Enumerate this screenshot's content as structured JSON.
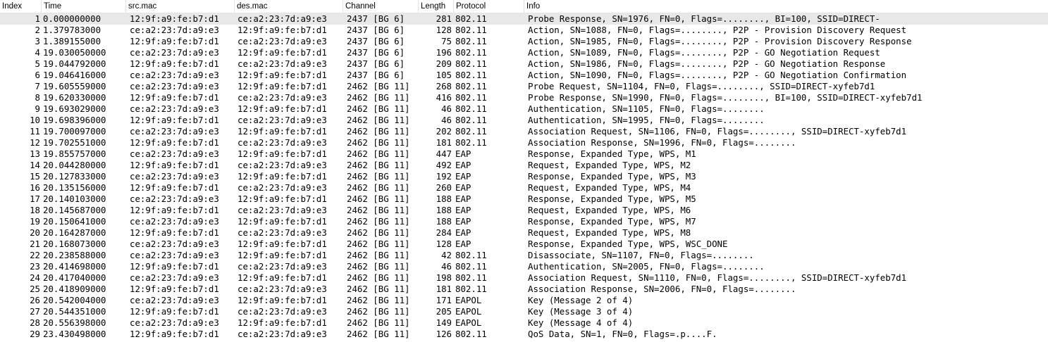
{
  "columns": {
    "index": "Index",
    "time": "Time",
    "src": "src.mac",
    "dst": "des.mac",
    "channel": "Channel",
    "length": "Length",
    "protocol": "Protocol",
    "info": "Info"
  },
  "rows": [
    {
      "index": "1",
      "time": "0.000000000",
      "src": "12:9f:a9:fe:b7:d1",
      "dst": "ce:a2:23:7d:a9:e3",
      "channel": "2437 [BG 6]",
      "length": "281",
      "protocol": "802.11",
      "info": "Probe Response, SN=1976, FN=0, Flags=........, BI=100, SSID=DIRECT-"
    },
    {
      "index": "2",
      "time": "1.379783000",
      "src": "ce:a2:23:7d:a9:e3",
      "dst": "12:9f:a9:fe:b7:d1",
      "channel": "2437 [BG 6]",
      "length": "128",
      "protocol": "802.11",
      "info": "Action, SN=1088, FN=0, Flags=........, P2P - Provision Discovery Request"
    },
    {
      "index": "3",
      "time": "1.389155000",
      "src": "12:9f:a9:fe:b7:d1",
      "dst": "ce:a2:23:7d:a9:e3",
      "channel": "2437 [BG 6]",
      "length": "75",
      "protocol": "802.11",
      "info": "Action, SN=1985, FN=0, Flags=........, P2P - Provision Discovery Response"
    },
    {
      "index": "4",
      "time": "19.030050000",
      "src": "ce:a2:23:7d:a9:e3",
      "dst": "12:9f:a9:fe:b7:d1",
      "channel": "2437 [BG 6]",
      "length": "196",
      "protocol": "802.11",
      "info": "Action, SN=1089, FN=0, Flags=........, P2P - GO Negotiation Request"
    },
    {
      "index": "5",
      "time": "19.044792000",
      "src": "12:9f:a9:fe:b7:d1",
      "dst": "ce:a2:23:7d:a9:e3",
      "channel": "2437 [BG 6]",
      "length": "209",
      "protocol": "802.11",
      "info": "Action, SN=1986, FN=0, Flags=........, P2P - GO Negotiation Response"
    },
    {
      "index": "6",
      "time": "19.046416000",
      "src": "ce:a2:23:7d:a9:e3",
      "dst": "12:9f:a9:fe:b7:d1",
      "channel": "2437 [BG 6]",
      "length": "105",
      "protocol": "802.11",
      "info": "Action, SN=1090, FN=0, Flags=........, P2P - GO Negotiation Confirmation"
    },
    {
      "index": "7",
      "time": "19.605559000",
      "src": "ce:a2:23:7d:a9:e3",
      "dst": "12:9f:a9:fe:b7:d1",
      "channel": "2462 [BG 11]",
      "length": "268",
      "protocol": "802.11",
      "info": "Probe Request, SN=1104, FN=0, Flags=........, SSID=DIRECT-xyfeb7d1"
    },
    {
      "index": "8",
      "time": "19.620330000",
      "src": "12:9f:a9:fe:b7:d1",
      "dst": "ce:a2:23:7d:a9:e3",
      "channel": "2462 [BG 11]",
      "length": "416",
      "protocol": "802.11",
      "info": "Probe Response, SN=1990, FN=0, Flags=........, BI=100, SSID=DIRECT-xyfeb7d1"
    },
    {
      "index": "9",
      "time": "19.693029000",
      "src": "ce:a2:23:7d:a9:e3",
      "dst": "12:9f:a9:fe:b7:d1",
      "channel": "2462 [BG 11]",
      "length": "46",
      "protocol": "802.11",
      "info": "Authentication, SN=1105, FN=0, Flags=........"
    },
    {
      "index": "10",
      "time": "19.698396000",
      "src": "12:9f:a9:fe:b7:d1",
      "dst": "ce:a2:23:7d:a9:e3",
      "channel": "2462 [BG 11]",
      "length": "46",
      "protocol": "802.11",
      "info": "Authentication, SN=1995, FN=0, Flags=........"
    },
    {
      "index": "11",
      "time": "19.700097000",
      "src": "ce:a2:23:7d:a9:e3",
      "dst": "12:9f:a9:fe:b7:d1",
      "channel": "2462 [BG 11]",
      "length": "202",
      "protocol": "802.11",
      "info": "Association Request, SN=1106, FN=0, Flags=........, SSID=DIRECT-xyfeb7d1"
    },
    {
      "index": "12",
      "time": "19.702551000",
      "src": "12:9f:a9:fe:b7:d1",
      "dst": "ce:a2:23:7d:a9:e3",
      "channel": "2462 [BG 11]",
      "length": "181",
      "protocol": "802.11",
      "info": "Association Response, SN=1996, FN=0, Flags=........"
    },
    {
      "index": "13",
      "time": "19.855757000",
      "src": "ce:a2:23:7d:a9:e3",
      "dst": "12:9f:a9:fe:b7:d1",
      "channel": "2462 [BG 11]",
      "length": "447",
      "protocol": "EAP",
      "info": "Response, Expanded Type, WPS, M1"
    },
    {
      "index": "14",
      "time": "20.044280000",
      "src": "12:9f:a9:fe:b7:d1",
      "dst": "ce:a2:23:7d:a9:e3",
      "channel": "2462 [BG 11]",
      "length": "492",
      "protocol": "EAP",
      "info": "Request, Expanded Type, WPS, M2"
    },
    {
      "index": "15",
      "time": "20.127833000",
      "src": "ce:a2:23:7d:a9:e3",
      "dst": "12:9f:a9:fe:b7:d1",
      "channel": "2462 [BG 11]",
      "length": "192",
      "protocol": "EAP",
      "info": "Response, Expanded Type, WPS, M3"
    },
    {
      "index": "16",
      "time": "20.135156000",
      "src": "12:9f:a9:fe:b7:d1",
      "dst": "ce:a2:23:7d:a9:e3",
      "channel": "2462 [BG 11]",
      "length": "260",
      "protocol": "EAP",
      "info": "Request, Expanded Type, WPS, M4"
    },
    {
      "index": "17",
      "time": "20.140103000",
      "src": "ce:a2:23:7d:a9:e3",
      "dst": "12:9f:a9:fe:b7:d1",
      "channel": "2462 [BG 11]",
      "length": "188",
      "protocol": "EAP",
      "info": "Response, Expanded Type, WPS, M5"
    },
    {
      "index": "18",
      "time": "20.145687000",
      "src": "12:9f:a9:fe:b7:d1",
      "dst": "ce:a2:23:7d:a9:e3",
      "channel": "2462 [BG 11]",
      "length": "188",
      "protocol": "EAP",
      "info": "Request, Expanded Type, WPS, M6"
    },
    {
      "index": "19",
      "time": "20.150641000",
      "src": "ce:a2:23:7d:a9:e3",
      "dst": "12:9f:a9:fe:b7:d1",
      "channel": "2462 [BG 11]",
      "length": "188",
      "protocol": "EAP",
      "info": "Response, Expanded Type, WPS, M7"
    },
    {
      "index": "20",
      "time": "20.164287000",
      "src": "12:9f:a9:fe:b7:d1",
      "dst": "ce:a2:23:7d:a9:e3",
      "channel": "2462 [BG 11]",
      "length": "284",
      "protocol": "EAP",
      "info": "Request, Expanded Type, WPS, M8"
    },
    {
      "index": "21",
      "time": "20.168073000",
      "src": "ce:a2:23:7d:a9:e3",
      "dst": "12:9f:a9:fe:b7:d1",
      "channel": "2462 [BG 11]",
      "length": "128",
      "protocol": "EAP",
      "info": "Response, Expanded Type, WPS, WSC_DONE"
    },
    {
      "index": "22",
      "time": "20.238588000",
      "src": "ce:a2:23:7d:a9:e3",
      "dst": "12:9f:a9:fe:b7:d1",
      "channel": "2462 [BG 11]",
      "length": "42",
      "protocol": "802.11",
      "info": "Disassociate, SN=1107, FN=0, Flags=........"
    },
    {
      "index": "23",
      "time": "20.414698000",
      "src": "12:9f:a9:fe:b7:d1",
      "dst": "ce:a2:23:7d:a9:e3",
      "channel": "2462 [BG 11]",
      "length": "46",
      "protocol": "802.11",
      "info": "Authentication, SN=2005, FN=0, Flags=........"
    },
    {
      "index": "24",
      "time": "20.417040000",
      "src": "ce:a2:23:7d:a9:e3",
      "dst": "12:9f:a9:fe:b7:d1",
      "channel": "2462 [BG 11]",
      "length": "198",
      "protocol": "802.11",
      "info": "Association Request, SN=1110, FN=0, Flags=........, SSID=DIRECT-xyfeb7d1"
    },
    {
      "index": "25",
      "time": "20.418909000",
      "src": "12:9f:a9:fe:b7:d1",
      "dst": "ce:a2:23:7d:a9:e3",
      "channel": "2462 [BG 11]",
      "length": "181",
      "protocol": "802.11",
      "info": "Association Response, SN=2006, FN=0, Flags=........"
    },
    {
      "index": "26",
      "time": "20.542004000",
      "src": "ce:a2:23:7d:a9:e3",
      "dst": "12:9f:a9:fe:b7:d1",
      "channel": "2462 [BG 11]",
      "length": "171",
      "protocol": "EAPOL",
      "info": "Key (Message 2 of 4)"
    },
    {
      "index": "27",
      "time": "20.544351000",
      "src": "12:9f:a9:fe:b7:d1",
      "dst": "ce:a2:23:7d:a9:e3",
      "channel": "2462 [BG 11]",
      "length": "205",
      "protocol": "EAPOL",
      "info": "Key (Message 3 of 4)"
    },
    {
      "index": "28",
      "time": "20.556398000",
      "src": "ce:a2:23:7d:a9:e3",
      "dst": "12:9f:a9:fe:b7:d1",
      "channel": "2462 [BG 11]",
      "length": "149",
      "protocol": "EAPOL",
      "info": "Key (Message 4 of 4)"
    },
    {
      "index": "29",
      "time": "23.430498000",
      "src": "12:9f:a9:fe:b7:d1",
      "dst": "ce:a2:23:7d:a9:e3",
      "channel": "2462 [BG 11]",
      "length": "126",
      "protocol": "802.11",
      "info": "QoS Data, SN=1, FN=0, Flags=.p....F."
    }
  ]
}
